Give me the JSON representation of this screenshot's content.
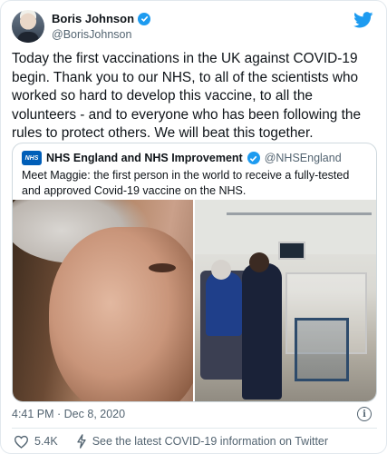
{
  "author": {
    "display_name": "Boris Johnson",
    "handle": "@BorisJohnson",
    "verified_icon": "verified-badge-icon",
    "avatar_icon": "avatar"
  },
  "brand": {
    "icon": "twitter-bird-icon",
    "color": "#1d9bf0"
  },
  "tweet": {
    "text": "Today the first vaccinations in the UK against COVID-19 begin. Thank you to our NHS, to all of the scientists who worked so hard to develop this vaccine, to all the volunteers - and to everyone who has been following the rules to protect others. We will beat this together.",
    "timestamp": "4:41 PM · Dec 8, 2020"
  },
  "quoted_tweet": {
    "logo_text": "NHS",
    "display_name": "NHS England and NHS Improvement",
    "handle": "@NHSEngland",
    "text": "Meet Maggie: the first person in the world to receive a fully-tested and approved Covid-19 vaccine on the NHS."
  },
  "actions": {
    "like_icon": "heart-icon",
    "like_count": "5.4K",
    "covid_icon": "lightning-icon",
    "covid_link": "See the latest COVID-19 information on Twitter"
  },
  "info_icon_glyph": "i",
  "colors": {
    "verified": "#1d9bf0",
    "secondary_text": "#536471",
    "nhs_blue": "#005eb8"
  }
}
